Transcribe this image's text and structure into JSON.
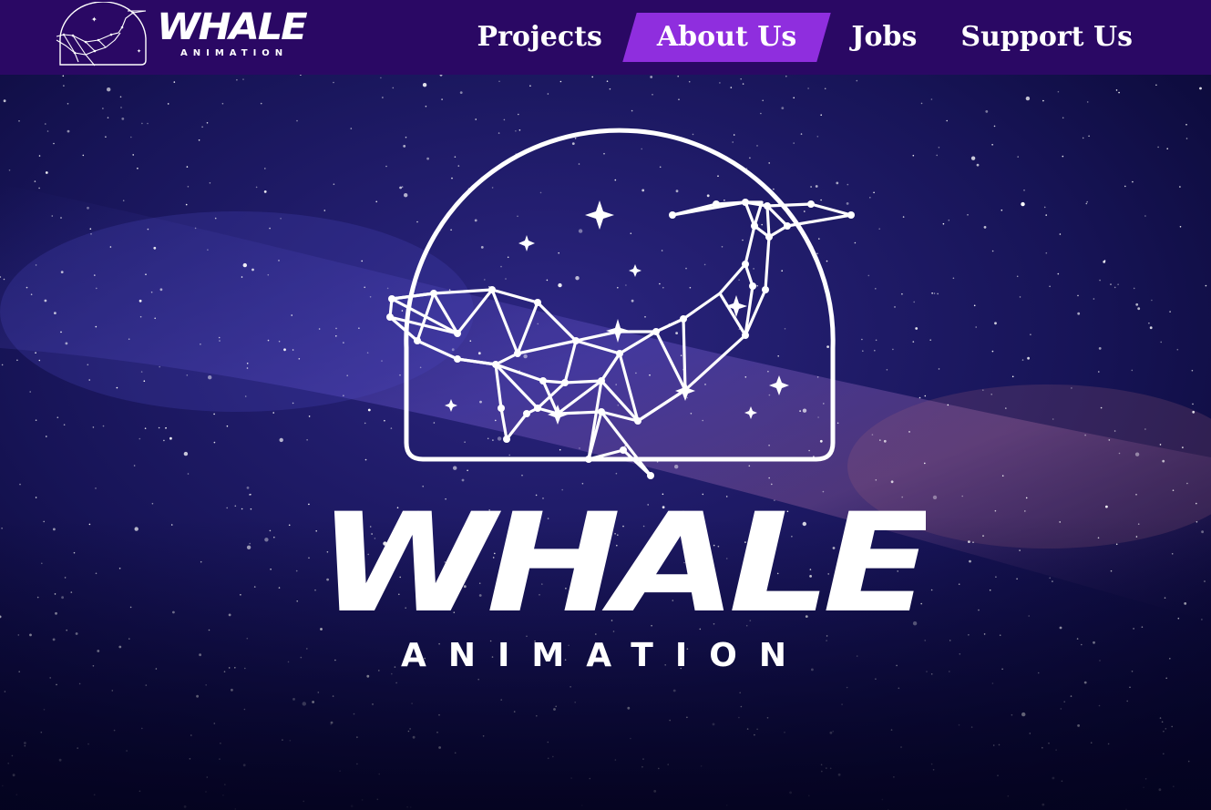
{
  "brand": {
    "name": "WHALE",
    "tagline": "ANIMATION",
    "colors": {
      "nav_bg": "#2a0864",
      "active_tab": "#8f2ede",
      "text": "#ffffff",
      "sky": "#06052a"
    }
  },
  "nav": {
    "items": [
      {
        "label": "Projects",
        "active": false
      },
      {
        "label": "About Us",
        "active": true
      },
      {
        "label": "Jobs",
        "active": false
      },
      {
        "label": "Support Us",
        "active": false
      }
    ]
  },
  "hero": {
    "title": "WHALE",
    "subtitle": "ANIMATION",
    "icon": "constellation-whale-icon",
    "background": "starry-night-sky"
  }
}
